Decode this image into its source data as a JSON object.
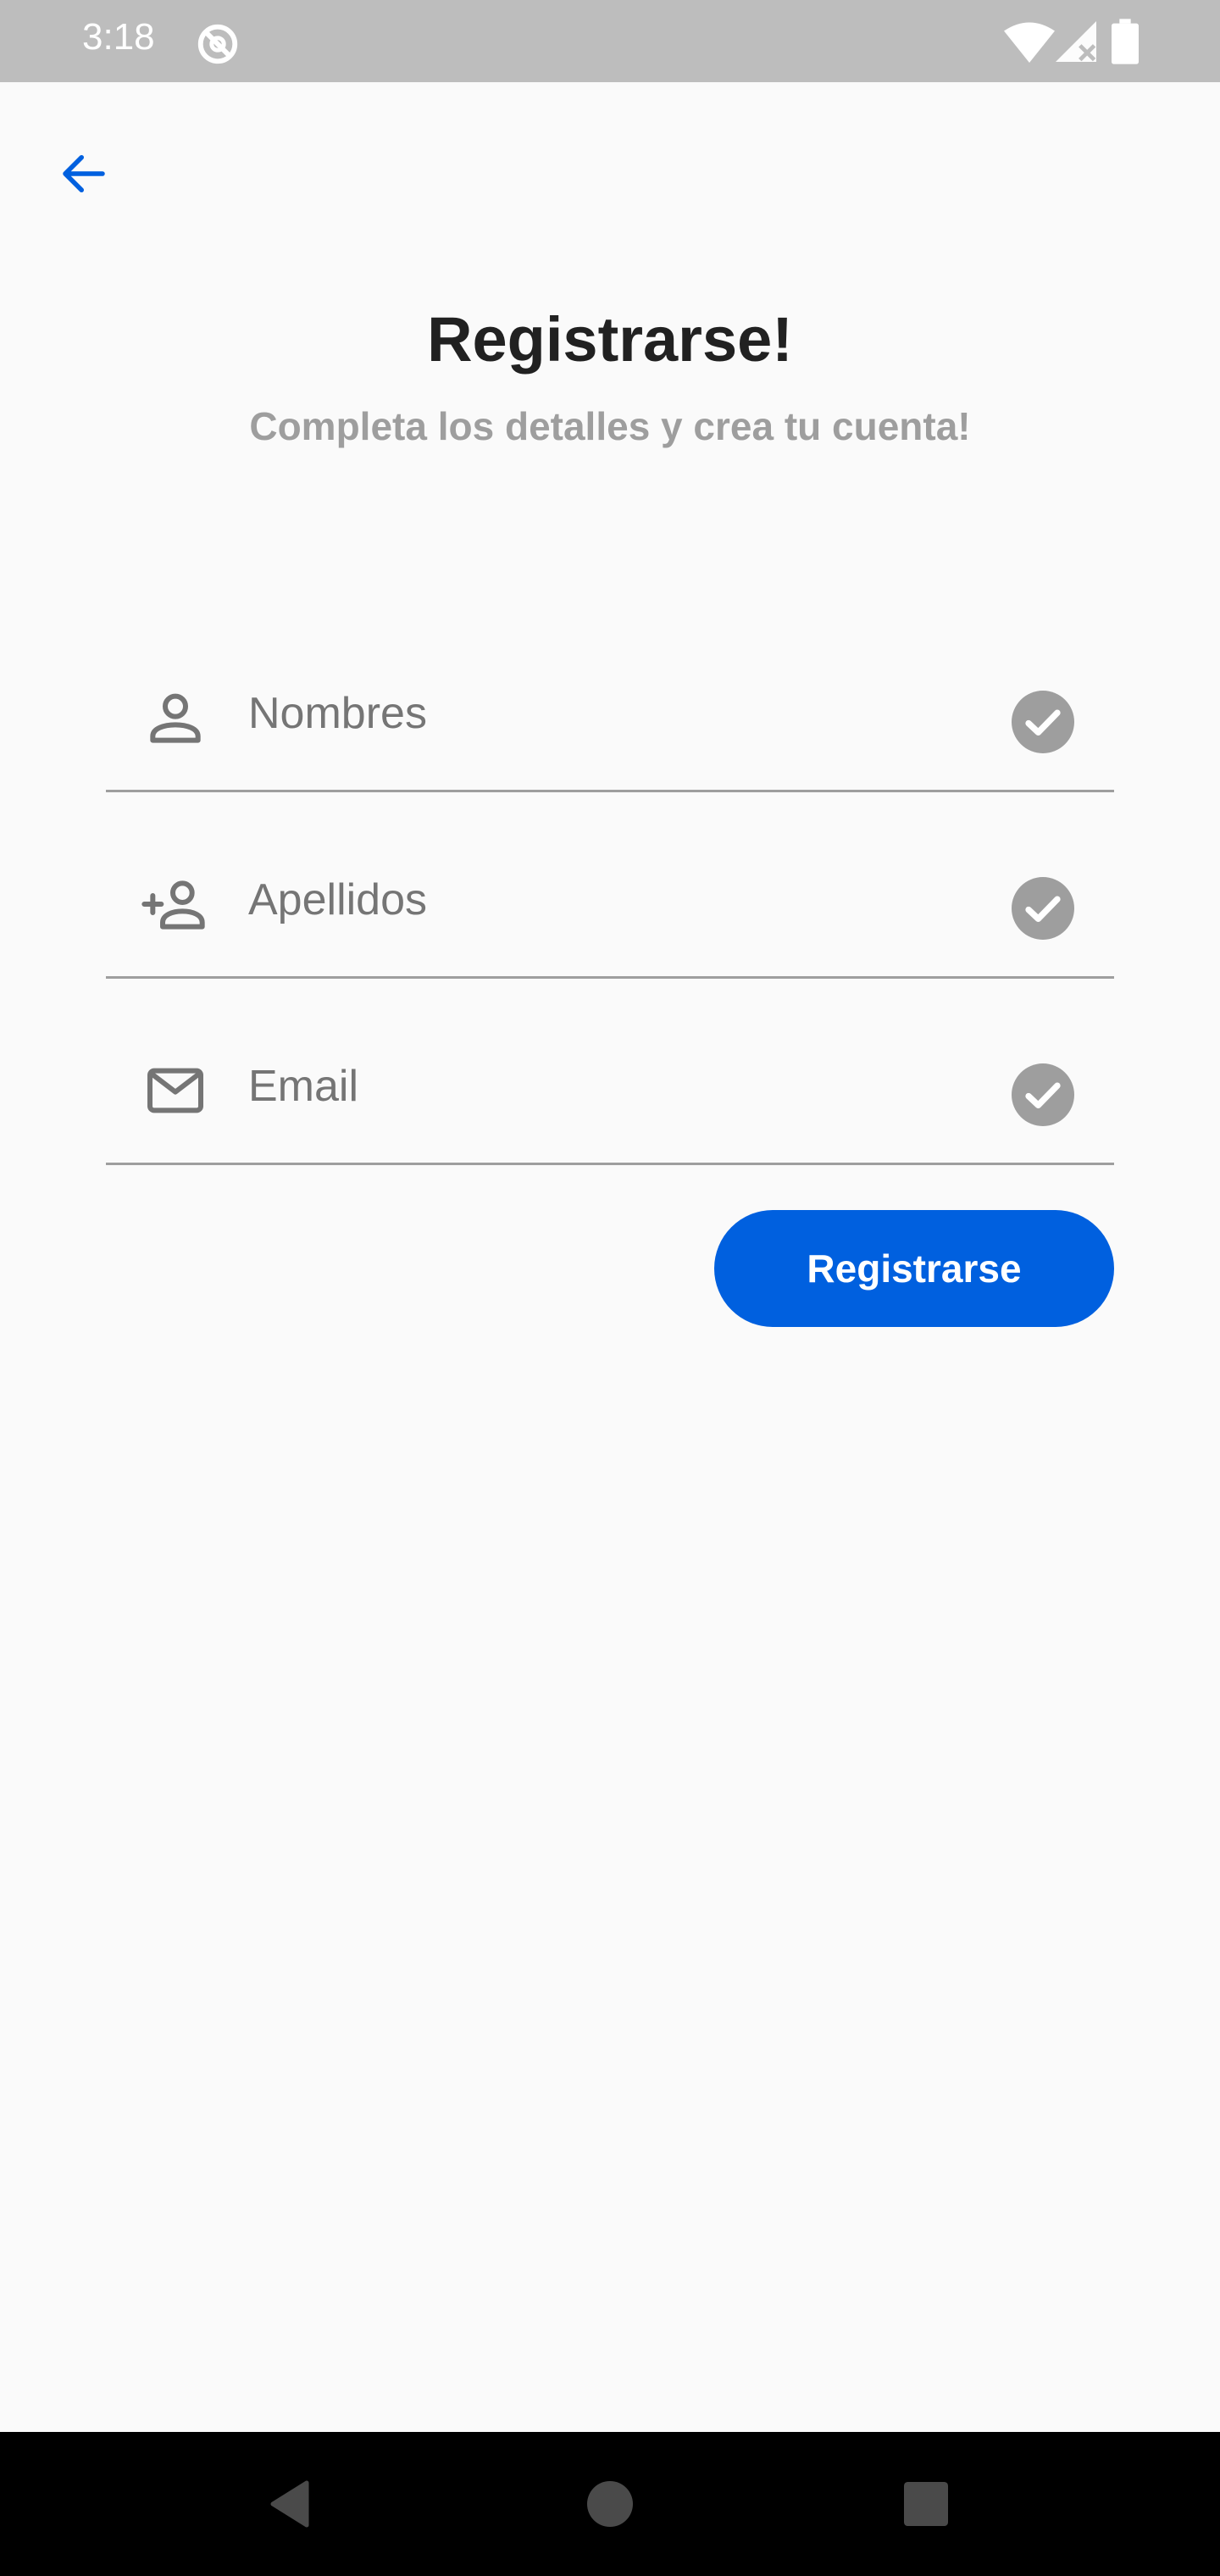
{
  "status_bar": {
    "time": "3:18",
    "icons": [
      "do-not-disturb-icon",
      "wifi-icon",
      "signal-icon",
      "battery-icon"
    ]
  },
  "header": {
    "back_icon": "arrow-left-icon"
  },
  "page": {
    "title": "Registrarse!",
    "subtitle": "Completa los detalles y crea tu cuenta!"
  },
  "form": {
    "fields": [
      {
        "placeholder": "Nombres",
        "icon": "person-icon",
        "valid_icon": "check-circle-icon"
      },
      {
        "placeholder": "Apellidos",
        "icon": "person-add-icon",
        "valid_icon": "check-circle-icon"
      },
      {
        "placeholder": "Email",
        "icon": "mail-icon",
        "valid_icon": "check-circle-icon"
      }
    ],
    "submit_label": "Registrarse"
  },
  "nav_bar": {
    "buttons": [
      "back-triangle-icon",
      "home-circle-icon",
      "recents-square-icon"
    ]
  },
  "colors": {
    "accent": "#0060df",
    "background": "#fafafa",
    "status_bar": "#bdbdbd",
    "text_primary": "#212121",
    "text_secondary": "#9e9e9e",
    "icon_gray": "#757575"
  }
}
